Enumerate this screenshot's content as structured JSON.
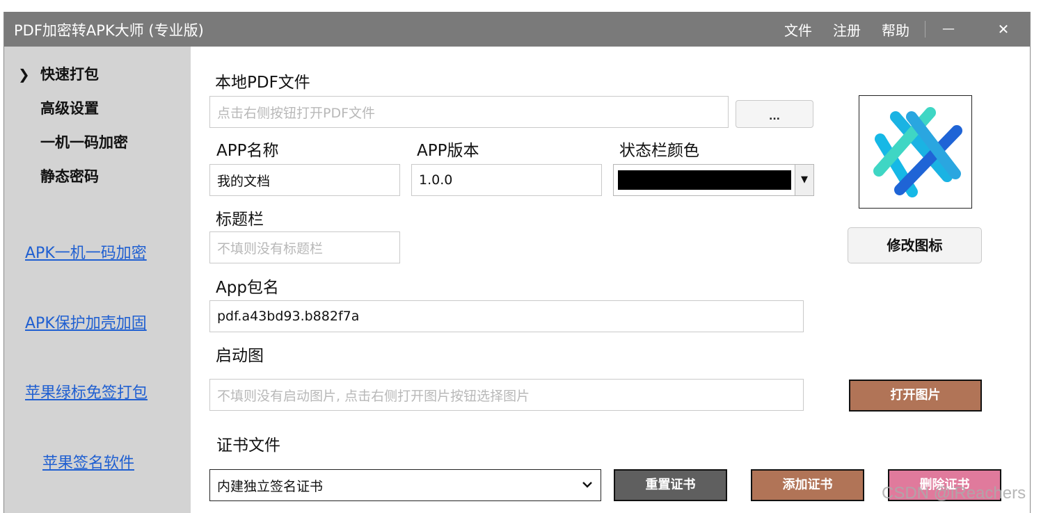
{
  "window": {
    "title": "PDF加密转APK大师 (专业版)",
    "menu": [
      "文件",
      "注册",
      "帮助"
    ],
    "minimize_glyph": "—",
    "close_glyph": "✕"
  },
  "sidebar": {
    "active_marker": "❯",
    "nav": [
      "快速打包",
      "高级设置",
      "一机一码加密",
      "静态密码"
    ],
    "links": [
      "APK一机一码加密",
      "APK保护加壳加固",
      "苹果绿标免签打包",
      "苹果签名软件"
    ],
    "bg_color": "#d3d3d3",
    "link_color": "#1f5fd1"
  },
  "form": {
    "pdf_label": "本地PDF文件",
    "pdf_placeholder": "点击右侧按钮打开PDF文件",
    "browse_label": "...",
    "app_name_label": "APP名称",
    "app_name_value": "我的文档",
    "app_version_label": "APP版本",
    "app_version_value": "1.0.0",
    "statusbar_color_label": "状态栏颜色",
    "statusbar_color_value": "#000000",
    "titlebar_label": "标题栏",
    "titlebar_placeholder": "不填则没有标题栏",
    "package_label": "App包名",
    "package_value": "pdf.a43bd93.b882f7a",
    "splash_label": "启动图",
    "splash_placeholder": "不填则没有启动图片, 点击右侧打开图片按钮选择图片",
    "cert_label": "证书文件",
    "cert_value": "内建独立签名证书"
  },
  "buttons": {
    "change_icon": "修改图标",
    "open_image": "打开图片",
    "reset_cert": "重置证书",
    "add_cert": "添加证书",
    "delete_cert": "删除证书"
  },
  "colors": {
    "titlebar": "#7a7a7a",
    "open_image_bg": "#b17457",
    "reset_cert_bg": "#5f5f5f",
    "add_cert_bg": "#b17457",
    "delete_cert_bg": "#e07a9c"
  },
  "icons": {
    "app_icon": "crossed-stripes-app-icon",
    "dropdown": "chevron-down-icon"
  },
  "watermark": "CSDN @iReachers"
}
